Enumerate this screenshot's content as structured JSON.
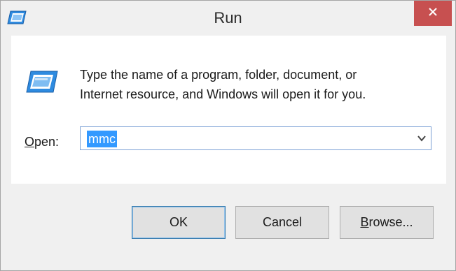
{
  "window": {
    "title": "Run",
    "close_icon": "close-icon",
    "icon": "run-icon"
  },
  "content": {
    "description_line1": "Type the name of a program, folder, document, or",
    "description_line2": "Internet resource, and Windows will open it for you.",
    "open_label_accel": "O",
    "open_label_rest": "pen:",
    "open_value": "mmc",
    "dropdown_icon": "chevron-down-icon"
  },
  "buttons": {
    "ok_label": "OK",
    "cancel_label": "Cancel",
    "browse_accel": "B",
    "browse_rest": "rowse..."
  },
  "colors": {
    "close_button": "#c75050",
    "selection": "#3399ff",
    "focus_border": "#7a9fd4"
  }
}
